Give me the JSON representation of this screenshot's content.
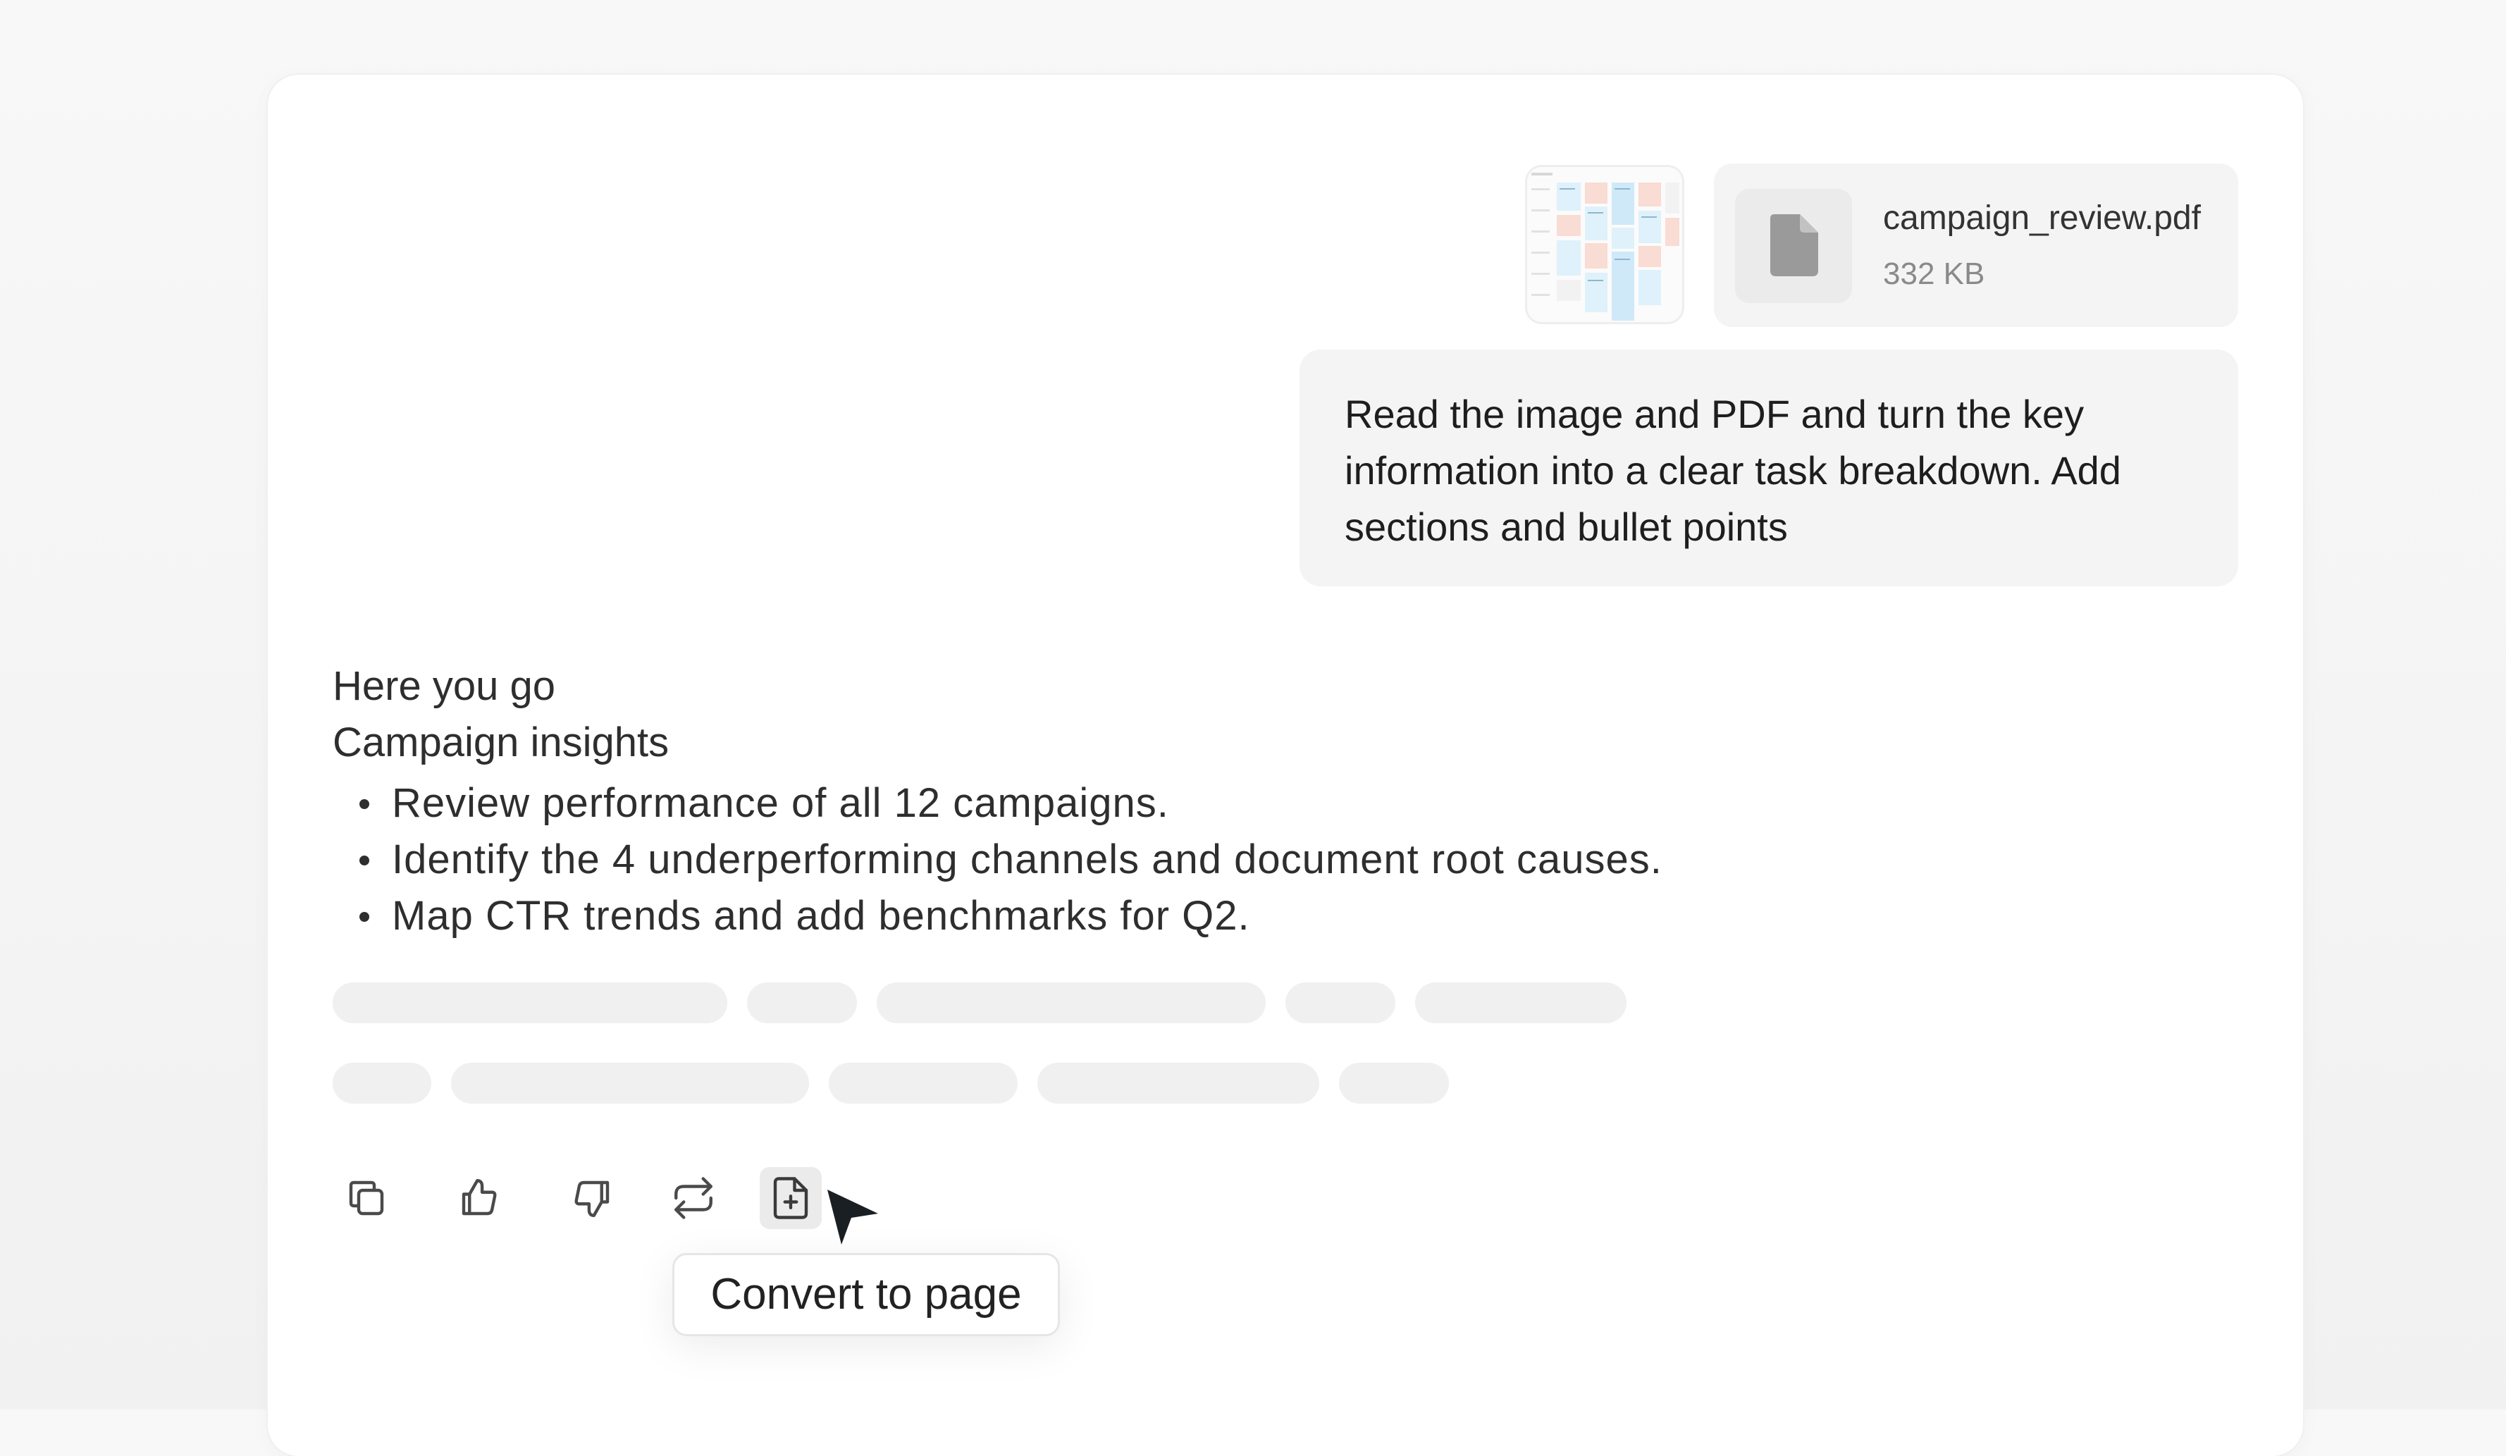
{
  "attachments": {
    "file": {
      "name": "campaign_review.pdf",
      "size": "332 KB",
      "icon": "document-icon"
    },
    "image": {
      "icon": "image-thumbnail"
    }
  },
  "user_message": {
    "text": "Read the image and PDF and turn the key information into a clear task breakdown. Add sections and bullet points"
  },
  "response": {
    "intro": "Here you go",
    "heading": "Campaign insights",
    "bullets": [
      "Review performance of all 12 campaigns.",
      "Identify the 4 underperforming channels and document root causes.",
      "Map CTR trends and add benchmarks for Q2."
    ]
  },
  "actions": [
    {
      "name": "copy",
      "icon": "copy-icon"
    },
    {
      "name": "like",
      "icon": "thumbs-up-icon"
    },
    {
      "name": "dislike",
      "icon": "thumbs-down-icon"
    },
    {
      "name": "regenerate",
      "icon": "repeat-icon"
    },
    {
      "name": "convert-to-page",
      "icon": "file-plus-icon",
      "active": true
    }
  ],
  "tooltip": {
    "text": "Convert to page"
  },
  "colors": {
    "page_background": "#f5f5f5",
    "panel": "#ffffff",
    "bubble": "#f4f4f4",
    "skeleton": "#f0f0f0",
    "icon": "#4a4a4a"
  }
}
